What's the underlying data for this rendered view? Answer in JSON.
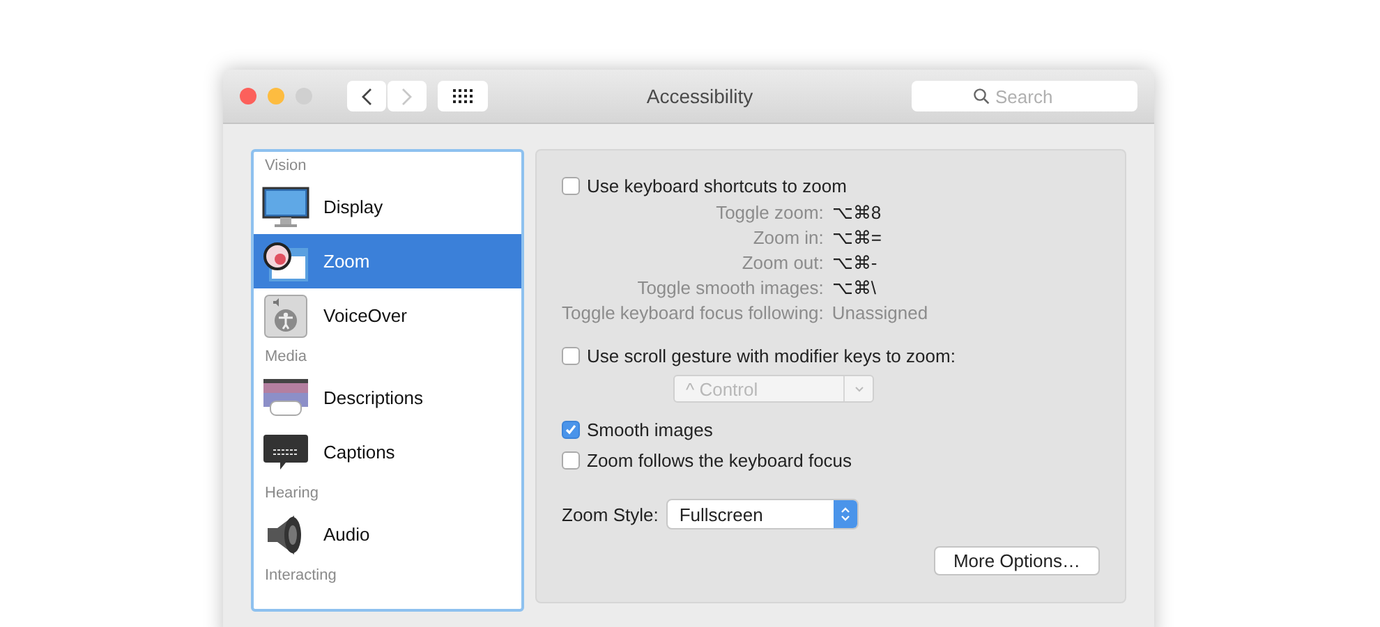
{
  "window": {
    "title": "Accessibility"
  },
  "toolbar": {
    "search": {
      "placeholder": "Search"
    }
  },
  "sidebar": {
    "items": [
      {
        "kind": "header",
        "label": "Vision"
      },
      {
        "kind": "item",
        "label": "Display",
        "selected": false
      },
      {
        "kind": "item",
        "label": "Zoom",
        "selected": true
      },
      {
        "kind": "item",
        "label": "VoiceOver",
        "selected": false
      },
      {
        "kind": "header",
        "label": "Media"
      },
      {
        "kind": "item",
        "label": "Descriptions",
        "selected": false
      },
      {
        "kind": "item",
        "label": "Captions",
        "selected": false
      },
      {
        "kind": "header",
        "label": "Hearing"
      },
      {
        "kind": "item",
        "label": "Audio",
        "selected": false
      },
      {
        "kind": "header",
        "label": "Interacting"
      }
    ]
  },
  "keyboard_shortcuts": {
    "label": "Use keyboard shortcuts to zoom",
    "checked": false,
    "shortcuts": [
      {
        "label": "Toggle zoom:",
        "value": "⌥⌘8"
      },
      {
        "label": "Zoom in:",
        "value": "⌥⌘="
      },
      {
        "label": "Zoom out:",
        "value": "⌥⌘-"
      },
      {
        "label": "Toggle smooth images:",
        "value": "⌥⌘\\"
      },
      {
        "label": "Toggle keyboard focus following:",
        "value": "Unassigned"
      }
    ]
  },
  "scroll_gesture": {
    "label": "Use scroll gesture with modifier keys to zoom:",
    "checked": false,
    "modifier": {
      "value": "^ Control",
      "disabled": true
    }
  },
  "options": [
    {
      "label": "Smooth images",
      "checked": true
    },
    {
      "label": "Zoom follows the keyboard focus",
      "checked": false
    }
  ],
  "zoom_style": {
    "label": "Zoom Style:",
    "value": "Fullscreen"
  },
  "buttons": [
    "More Options…"
  ]
}
